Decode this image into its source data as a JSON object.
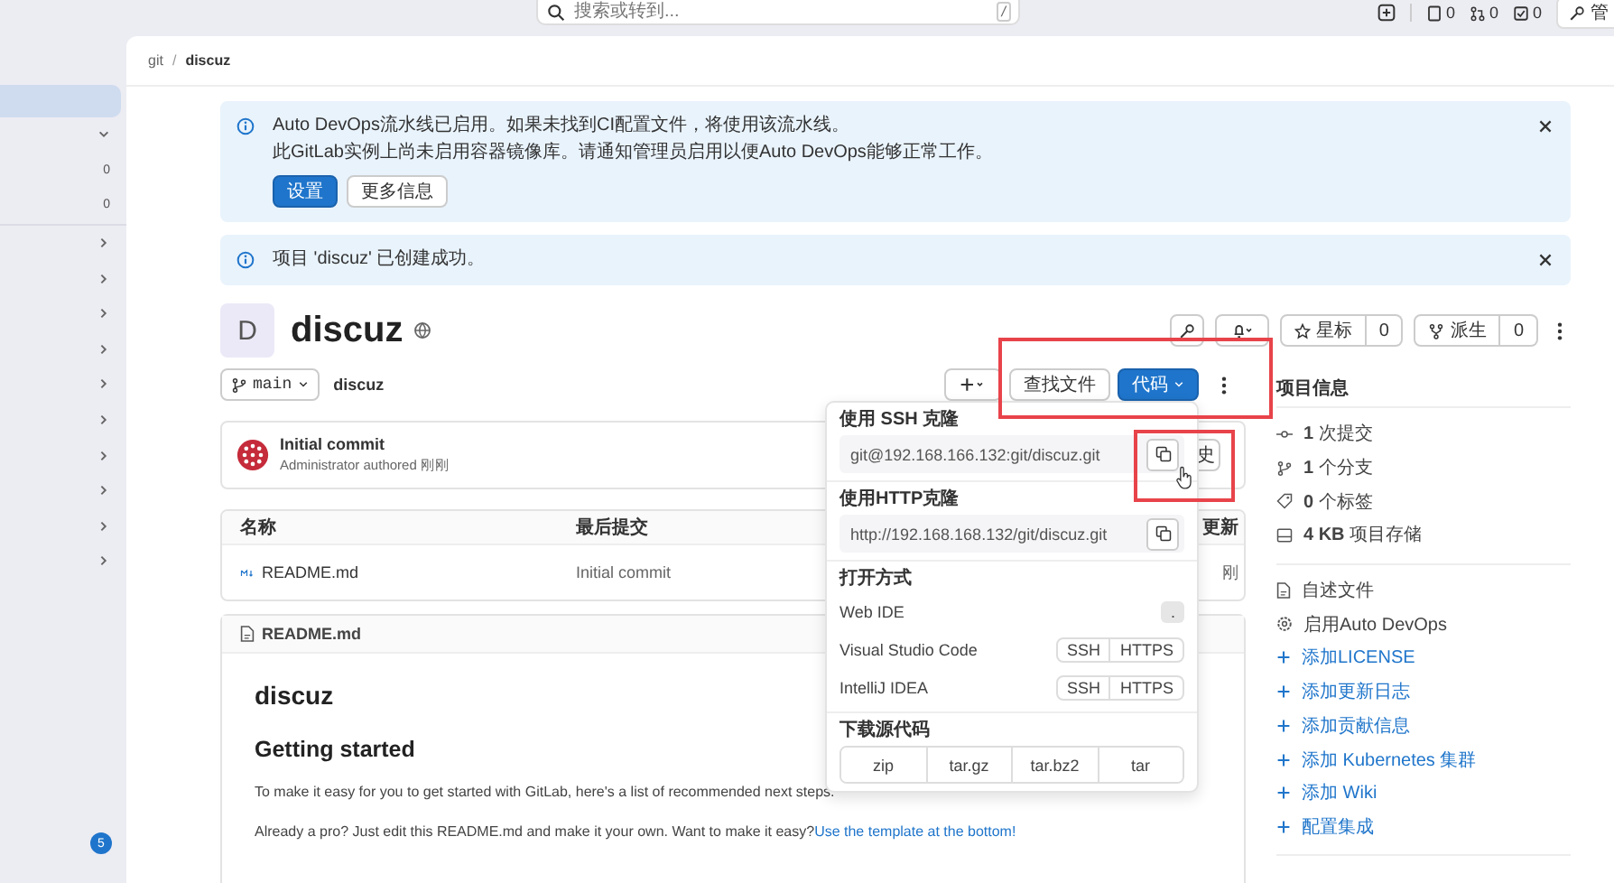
{
  "top_bar": {
    "search_placeholder": "搜索或转到...",
    "shortcut": "/",
    "counters": [
      {
        "kind": "issues",
        "count": "0"
      },
      {
        "kind": "merge",
        "count": "0"
      },
      {
        "kind": "todo",
        "count": "0"
      }
    ],
    "admin_button": "管"
  },
  "sidebar": {
    "groups": [
      {
        "expanded": true,
        "counts": [
          "0",
          "0"
        ]
      },
      {
        "expanded": false
      },
      {
        "expanded": false
      },
      {
        "expanded": false
      },
      {
        "expanded": false
      },
      {
        "expanded": false
      },
      {
        "expanded": false
      },
      {
        "expanded": false
      },
      {
        "expanded": false
      },
      {
        "expanded": false
      },
      {
        "expanded": false
      }
    ],
    "badge": "5"
  },
  "breadcrumb": {
    "items": [
      "git",
      "discuz"
    ],
    "separator": "/"
  },
  "alerts": [
    {
      "lines": [
        "Auto DevOps流水线已启用。如果未找到CI配置文件，将使用该流水线。",
        "此GitLab实例上尚未启用容器镜像库。请通知管理员启用以便Auto DevOps能够正常工作。"
      ],
      "buttons": [
        {
          "label": "设置",
          "primary": true
        },
        {
          "label": "更多信息",
          "primary": false
        }
      ]
    },
    {
      "lines": [
        "项目 'discuz' 已创建成功。"
      ]
    }
  ],
  "project": {
    "avatar": "D",
    "name": "discuz",
    "star_label": "星标",
    "star_count": "0",
    "fork_label": "派生",
    "fork_count": "0"
  },
  "repo_bar": {
    "branch": "main",
    "path": "discuz",
    "find_file": "查找文件",
    "code": "代码"
  },
  "commit": {
    "title": "Initial commit",
    "byline": "Administrator authored 刚刚",
    "history_button": "史"
  },
  "file_table": {
    "columns": [
      "名称",
      "最后提交",
      "更新"
    ],
    "rows": [
      {
        "name": "README.md",
        "commit": "Initial commit",
        "updated": "刚"
      }
    ]
  },
  "readme": {
    "filename": "README.md",
    "title": "discuz",
    "heading": "Getting started",
    "paragraphs": [
      {
        "text": "To make it easy for you to get started with GitLab, here's a list of recommended next steps."
      },
      {
        "text": "Already a pro? Just edit this README.md and make it your own. Want to make it easy?",
        "link": "Use the template at the bottom!"
      }
    ]
  },
  "project_info": {
    "title": "项目信息",
    "stats": [
      {
        "kind": "commits",
        "label": "**1** 次提交"
      },
      {
        "kind": "branches",
        "label": "**1** 个分支"
      },
      {
        "kind": "tags",
        "label": "**0** 个标签"
      },
      {
        "kind": "storage",
        "label": "**4 KB** 项目存储"
      }
    ],
    "actions": [
      {
        "kind": "readme",
        "label": "自述文件"
      },
      {
        "kind": "devops",
        "label": "启用Auto DevOps"
      },
      {
        "kind": "add",
        "label": "添加LICENSE"
      },
      {
        "kind": "add",
        "label": "添加更新日志"
      },
      {
        "kind": "add",
        "label": "添加贡献信息"
      },
      {
        "kind": "add",
        "label": "添加 Kubernetes 集群"
      },
      {
        "kind": "add",
        "label": "添加 Wiki"
      },
      {
        "kind": "add",
        "label": "配置集成"
      }
    ]
  },
  "clone_dropdown": {
    "ssh_title": "使用 SSH 克隆",
    "ssh_url": "git@192.168.166.132:git/discuz.git",
    "http_title": "使用HTTP克隆",
    "http_url": "http://192.168.168.132/git/discuz.git",
    "open_title": "打开方式",
    "open_with": [
      {
        "name": "Web IDE",
        "options": [
          "."
        ]
      },
      {
        "name": "Visual Studio Code",
        "options": [
          "SSH",
          "HTTPS"
        ]
      },
      {
        "name": "IntelliJ IDEA",
        "options": [
          "SSH",
          "HTTPS"
        ]
      }
    ],
    "download_title": "下载源代码",
    "formats": [
      "zip",
      "tar.gz",
      "tar.bz2",
      "tar"
    ]
  }
}
